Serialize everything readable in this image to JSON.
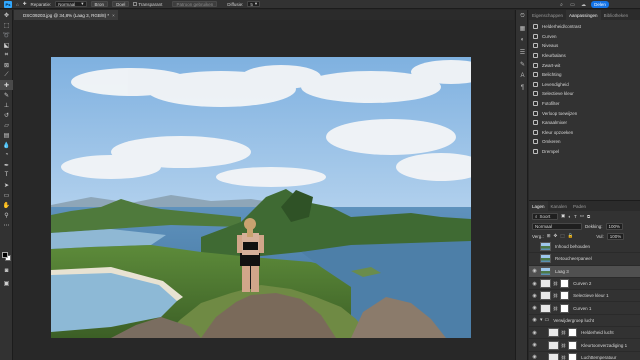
{
  "options_bar": {
    "app_badge": "Ps",
    "mode_label": "Reparatie:",
    "mode_value": "Normaal",
    "source_button": "Bron",
    "destination_button": "Doel",
    "transparent_label": "Transparant",
    "pattern_button": "Patroon gebruiken",
    "diffusion_label": "Diffusie:",
    "diffusion_value": "5",
    "share_label": "Delen"
  },
  "document": {
    "tab_title": "DSC09203.jpg @ 34,8% (Laag 3, RGB/8) *",
    "close_glyph": "×"
  },
  "panels": {
    "top_tabs": [
      "Eigenschappen",
      "Aanpassingen",
      "Bibliotheken"
    ],
    "active_top_tab": "Aanpassingen",
    "adjustments": [
      "Helderheid/contrast",
      "Curven",
      "Niveaus",
      "Kleurbalans",
      "Zwart-wit",
      "Belichting",
      "Levendigheid",
      "Selectieve kleur",
      "Fotofilter",
      "Verloop toewijzen",
      "Kanaalmixer",
      "Kleur opzoeken",
      "Omkeren",
      "Drempel"
    ],
    "layer_tabs": [
      "Lagen",
      "Kanalen",
      "Paden"
    ],
    "active_layer_tab": "Lagen",
    "filter_value": "Soort",
    "blend_mode": "Normaal",
    "opacity_label": "Dekking:",
    "opacity_value": "100%",
    "lock_label": "Verg.:",
    "fill_label": "Vul:",
    "fill_value": "100%",
    "layers": [
      {
        "name": "Inhoud behouden",
        "kind": "img",
        "visible": false,
        "mask": false,
        "selected": false,
        "indent": false
      },
      {
        "name": "Retoucheerpaneel",
        "kind": "img",
        "visible": false,
        "mask": false,
        "selected": false,
        "indent": false
      },
      {
        "name": "Laag 3",
        "kind": "img",
        "visible": true,
        "mask": false,
        "selected": true,
        "indent": false
      },
      {
        "name": "Curven 2",
        "kind": "adj",
        "visible": true,
        "mask": true,
        "selected": false,
        "indent": false
      },
      {
        "name": "Selectieve kleur 1",
        "kind": "adj",
        "visible": true,
        "mask": true,
        "selected": false,
        "indent": false
      },
      {
        "name": "Curven 1",
        "kind": "adj",
        "visible": true,
        "mask": true,
        "selected": false,
        "indent": false
      },
      {
        "name": "Verwijdergroep lucht",
        "kind": "folder",
        "visible": true,
        "mask": false,
        "selected": false,
        "indent": false
      },
      {
        "name": "Helderheid lucht",
        "kind": "adj",
        "visible": true,
        "mask": true,
        "selected": false,
        "indent": true
      },
      {
        "name": "Kleurtoonverzadiging 1",
        "kind": "adj",
        "visible": true,
        "mask": true,
        "selected": false,
        "indent": true
      },
      {
        "name": "Luchttemperatuur",
        "kind": "adj",
        "visible": true,
        "mask": true,
        "selected": false,
        "indent": true
      }
    ]
  },
  "colors": {
    "accent": "#1473e6",
    "foreground_swatch": "#000000",
    "background_swatch": "#ffffff",
    "panel_bg": "#323232",
    "workspace_bg": "#282828"
  }
}
